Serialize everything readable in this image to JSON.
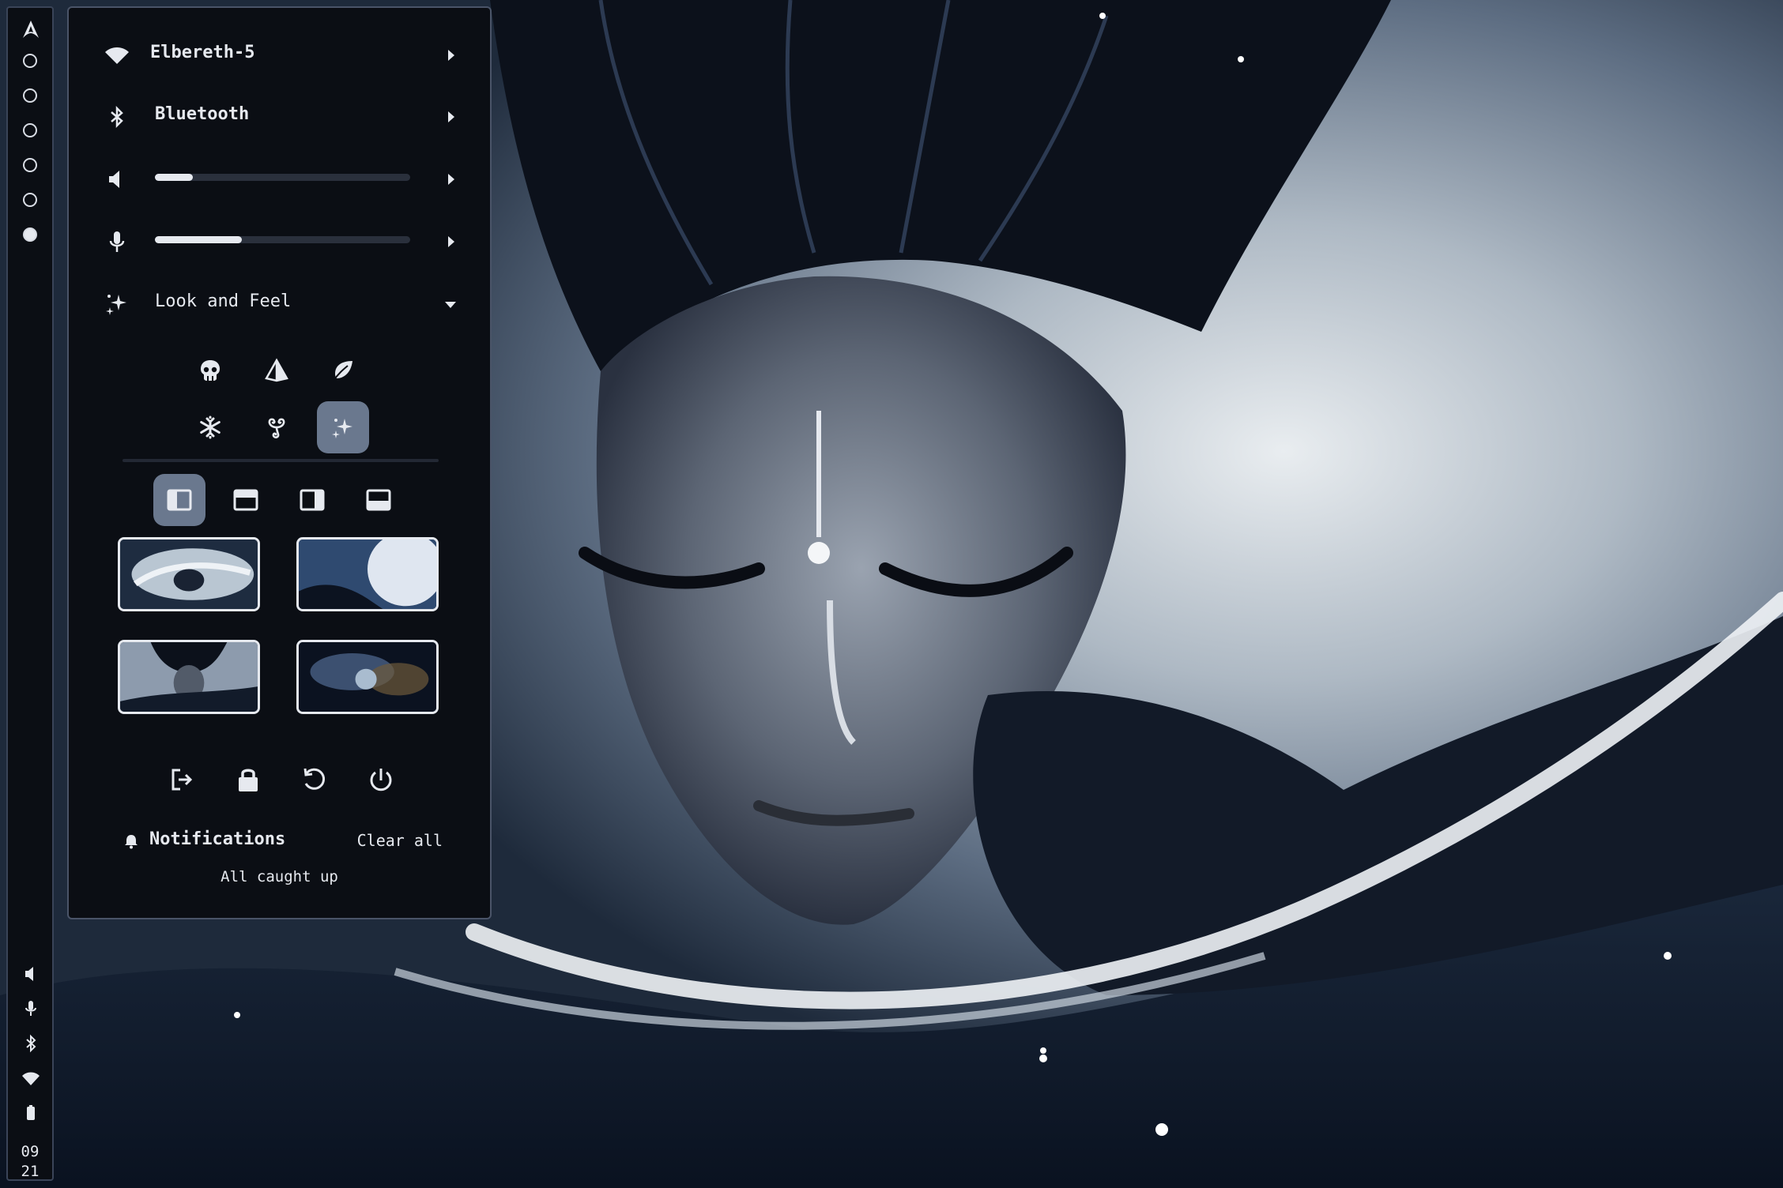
{
  "colors": {
    "panel_bg": "#0b0e14",
    "panel_border": "#4a5468",
    "text": "#e6e9ef",
    "selected_bg": "#6a788e",
    "slider_track": "#2a303c"
  },
  "sidebar": {
    "logo_icon": "arch-logo-icon",
    "workspaces": [
      {
        "id": 1,
        "active": false
      },
      {
        "id": 2,
        "active": false
      },
      {
        "id": 3,
        "active": false
      },
      {
        "id": 4,
        "active": false
      },
      {
        "id": 5,
        "active": false
      },
      {
        "id": 6,
        "active": true
      }
    ],
    "status_icons": [
      "volume-icon",
      "microphone-icon",
      "bluetooth-icon",
      "wifi-icon",
      "battery-icon"
    ],
    "clock": {
      "hour": "09",
      "minute": "21"
    }
  },
  "panel": {
    "wifi": {
      "label": "Elbereth-5",
      "icon": "wifi-icon"
    },
    "bluetooth": {
      "label": "Bluetooth",
      "icon": "bluetooth-icon"
    },
    "volume": {
      "icon": "volume-icon",
      "level": 0.15
    },
    "microphone": {
      "icon": "microphone-icon",
      "level": 0.34
    },
    "look_and_feel": {
      "label": "Look and Feel",
      "icon": "sparkles-icon",
      "expanded": true,
      "themes": [
        {
          "icon": "skull-icon",
          "selected": false
        },
        {
          "icon": "pyramid-icon",
          "selected": false
        },
        {
          "icon": "leaf-icon",
          "selected": false
        },
        {
          "icon": "snowflake-icon",
          "selected": false
        },
        {
          "icon": "triskelion-icon",
          "selected": false
        },
        {
          "icon": "sparkles-icon",
          "selected": true
        }
      ],
      "layouts": [
        {
          "icon": "layout-left-icon",
          "selected": true
        },
        {
          "icon": "layout-top-icon",
          "selected": false
        },
        {
          "icon": "layout-right-icon",
          "selected": false
        },
        {
          "icon": "layout-bottom-icon",
          "selected": false
        }
      ],
      "wallpapers": [
        {
          "name": "wallpaper-storm-figure"
        },
        {
          "name": "wallpaper-moon-hill"
        },
        {
          "name": "wallpaper-dark-portrait"
        },
        {
          "name": "wallpaper-nebula-planet"
        }
      ]
    },
    "power_actions": [
      {
        "icon": "logout-icon"
      },
      {
        "icon": "lock-icon"
      },
      {
        "icon": "restart-icon"
      },
      {
        "icon": "power-icon"
      }
    ],
    "notifications": {
      "title": "Notifications",
      "clear_label": "Clear all",
      "empty_text": "All caught up"
    }
  }
}
